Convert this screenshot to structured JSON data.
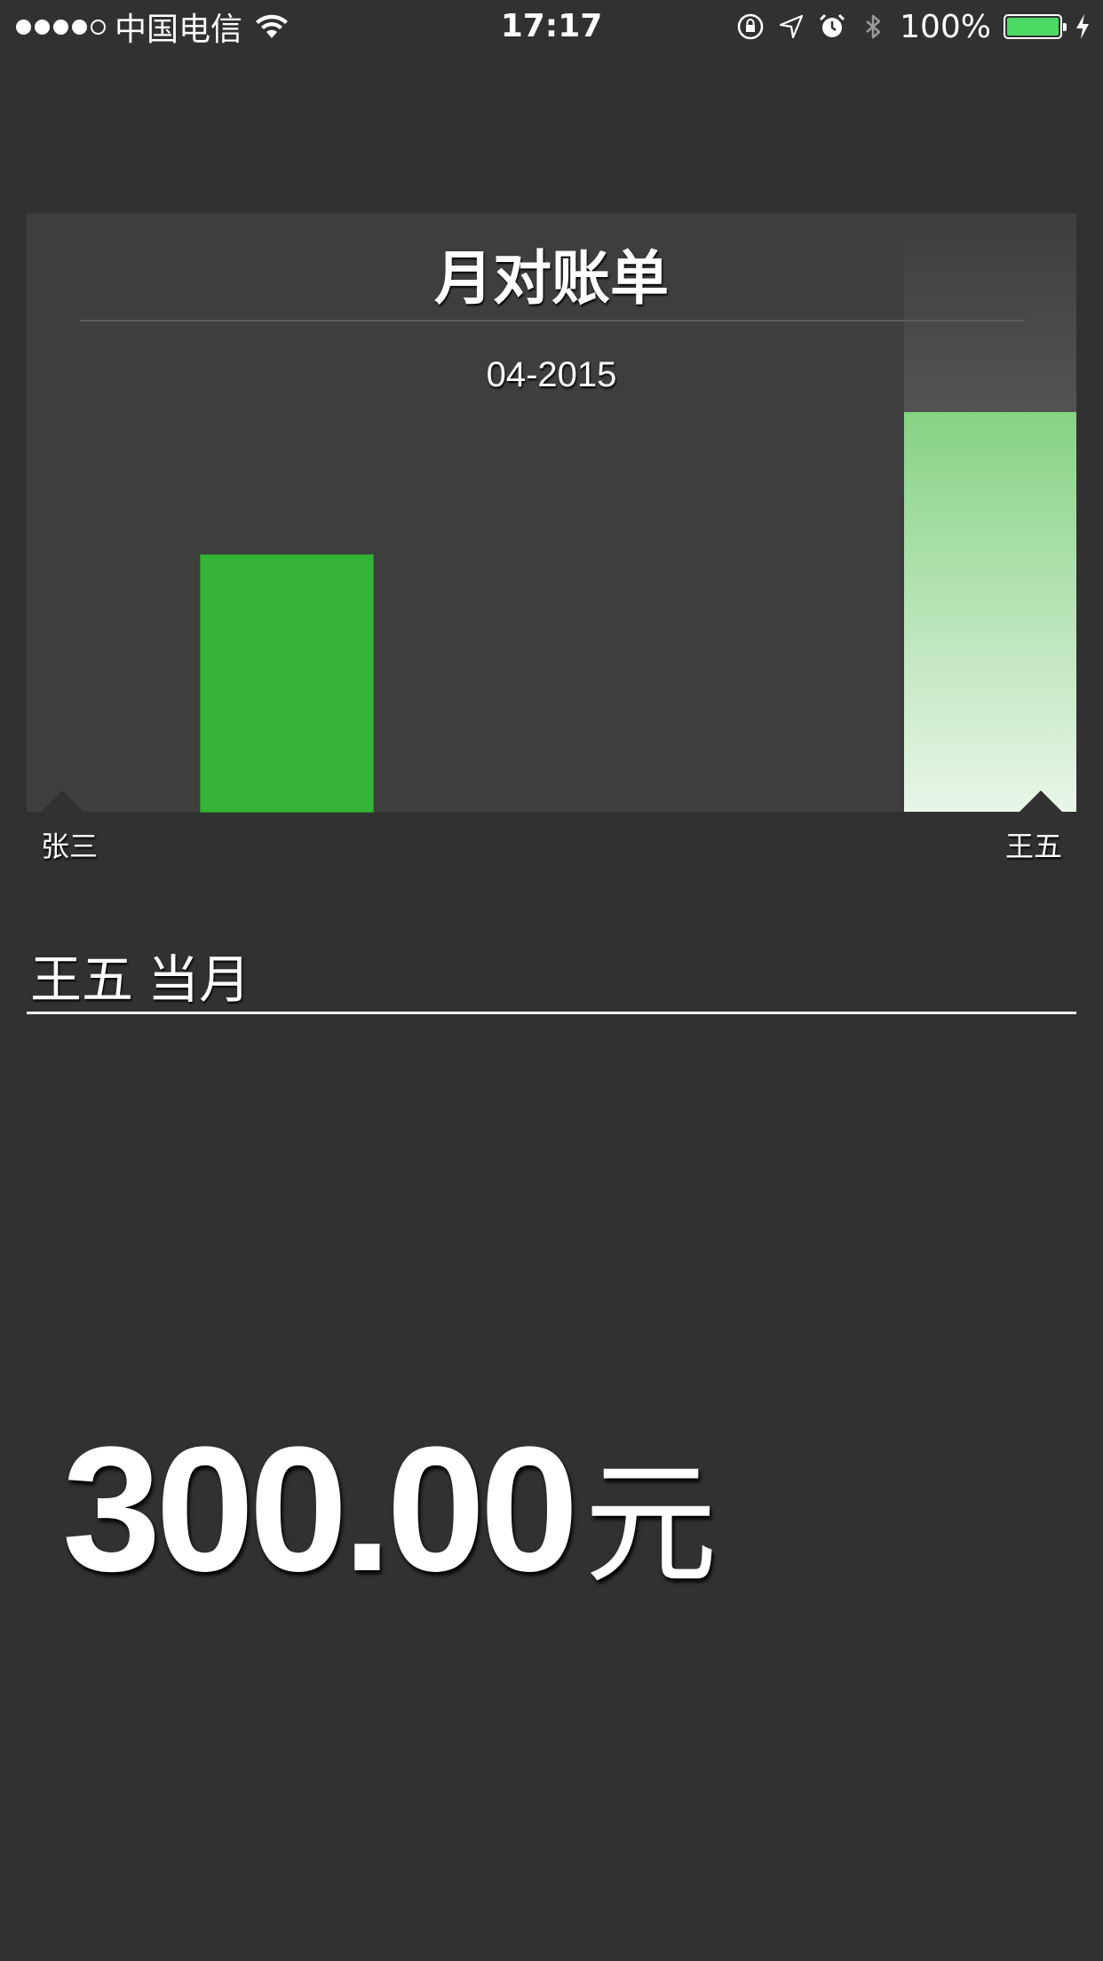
{
  "status_bar": {
    "signal_filled": 4,
    "signal_total": 5,
    "carrier": "中国电信",
    "time": "17:17",
    "battery_percent": "100%",
    "icons": [
      "wifi-icon",
      "orientation-lock-icon",
      "location-icon",
      "alarm-icon",
      "bluetooth-icon",
      "battery-icon",
      "charging-icon"
    ]
  },
  "card": {
    "title": "月对账单",
    "date": "04-2015"
  },
  "chart_data": {
    "type": "bar",
    "categories": [
      "张三",
      "",
      "",
      "",
      "王五"
    ],
    "values": [
      300,
      0,
      0,
      0,
      467
    ],
    "ylim": [
      0,
      700
    ],
    "selected_index": 4,
    "colors": {
      "bar": "#35b336",
      "selected_bar_top": "#86d284",
      "selected_bar_bottom": "#e9f6e8"
    }
  },
  "section": {
    "title": "王五 当月"
  },
  "amount": {
    "value": "300.00",
    "unit": "元"
  },
  "colors": {
    "background": "#313131",
    "card": "#3e3e3e",
    "accent_green": "#35b336",
    "battery_green": "#4cd964"
  }
}
